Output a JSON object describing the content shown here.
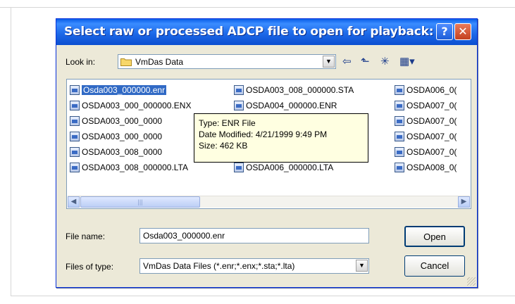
{
  "dialog": {
    "title": "Select raw or processed ADCP file to open for playback:",
    "help_glyph": "?",
    "close_glyph": "✕"
  },
  "lookin": {
    "label": "Look in:",
    "value": "VmDas Data",
    "arrow_glyph": "▼"
  },
  "toolbar": {
    "back_icon": "back-arrow-icon",
    "back_glyph": "⇦",
    "up_icon": "up-folder-icon",
    "up_glyph": "⬑",
    "new_folder_icon": "new-folder-icon",
    "new_folder_glyph": "✳",
    "view_menu_icon": "view-menu-icon",
    "view_menu_glyph": "▦▾"
  },
  "files": {
    "col1": [
      "Osda003_000000.enr",
      "OSDA003_000_000000.ENX",
      "OSDA003_000_0000",
      "OSDA003_000_0000",
      "OSDA003_008_0000",
      "OSDA003_008_000000.LTA"
    ],
    "col2": [
      "OSDA003_008_000000.STA",
      "OSDA004_000000.ENR",
      "",
      "",
      "",
      "OSDA006_000000.LTA"
    ],
    "col3": [
      "OSDA006_0(",
      "OSDA007_0(",
      "OSDA007_0(",
      "OSDA007_0(",
      "OSDA007_0(",
      "OSDA008_0("
    ]
  },
  "tooltip": {
    "type": "Type: ENR File",
    "modified": "Date Modified: 4/21/1999 9:49 PM",
    "size": "Size: 462 KB"
  },
  "scroll": {
    "left_glyph": "◀",
    "right_glyph": "▶",
    "thumb_glyph": "|||"
  },
  "filename": {
    "label": "File name:",
    "value": "Osda003_000000.enr"
  },
  "filetype": {
    "label": "Files of type:",
    "value": "VmDas Data Files (*.enr;*.enx;*.sta;*.lta)",
    "arrow_glyph": "▼"
  },
  "buttons": {
    "open": "Open",
    "cancel": "Cancel"
  },
  "colors": {
    "title_bar": "#1b66e6",
    "dialog_bg": "#ece9d8",
    "selection": "#316ac5",
    "tooltip_bg": "#ffffe1"
  }
}
